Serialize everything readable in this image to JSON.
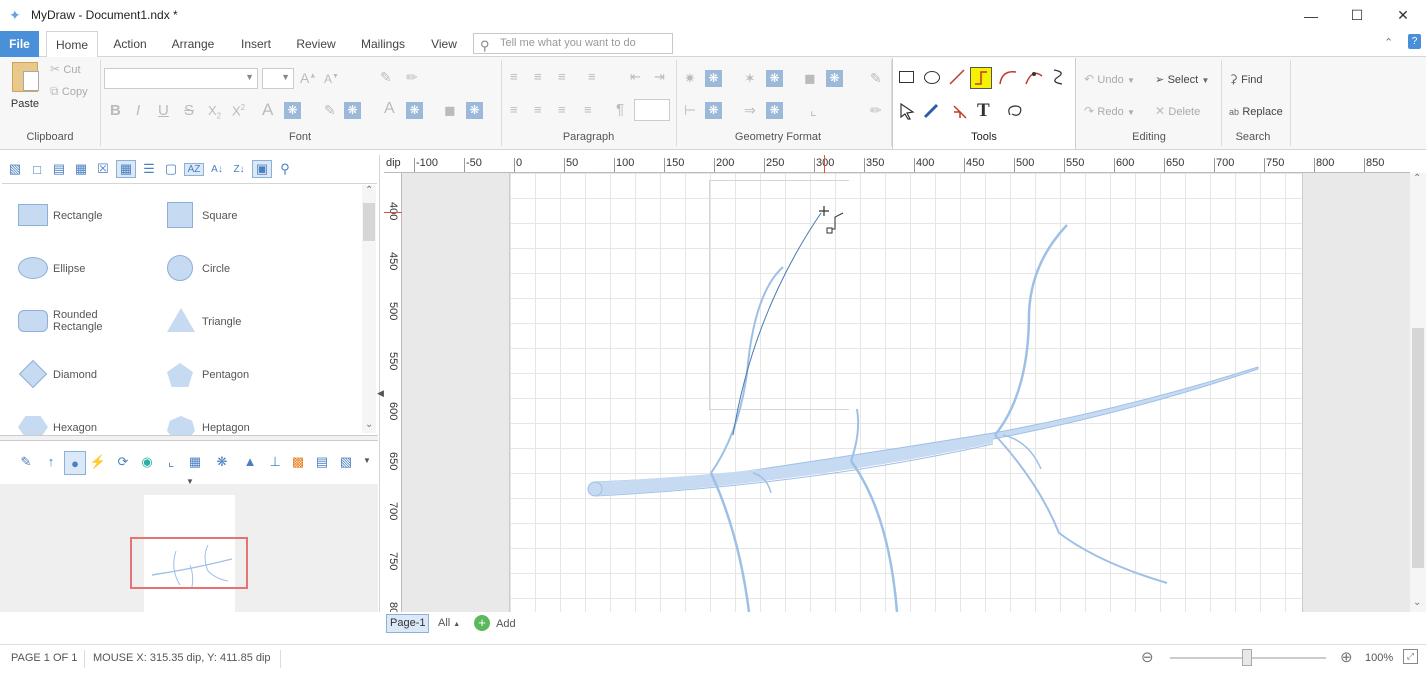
{
  "app": {
    "title": "MyDraw - Document1.ndx *"
  },
  "window_controls": {
    "minimize": "—",
    "maximize": "☐",
    "close": "✕"
  },
  "tabs": [
    {
      "label": "File"
    },
    {
      "label": "Home"
    },
    {
      "label": "Action"
    },
    {
      "label": "Arrange"
    },
    {
      "label": "Insert"
    },
    {
      "label": "Review"
    },
    {
      "label": "Mailings"
    },
    {
      "label": "View"
    }
  ],
  "search": {
    "placeholder": "Tell me what you want to do"
  },
  "ribbon": {
    "clipboard": {
      "label": "Clipboard",
      "paste": "Paste",
      "cut": "Cut",
      "copy": "Copy"
    },
    "font": {
      "label": "Font"
    },
    "paragraph": {
      "label": "Paragraph"
    },
    "geometry": {
      "label": "Geometry Format"
    },
    "tools": {
      "label": "Tools"
    },
    "editing": {
      "label": "Editing",
      "undo": "Undo",
      "redo": "Redo",
      "select": "Select",
      "delete": "Delete"
    },
    "search": {
      "label": "Search",
      "find": "Find",
      "replace": "Replace"
    }
  },
  "shapes": [
    {
      "label": "Rectangle",
      "kind": "rect"
    },
    {
      "label": "Square",
      "kind": "square"
    },
    {
      "label": "Ellipse",
      "kind": "ellipse"
    },
    {
      "label": "Circle",
      "kind": "circle"
    },
    {
      "label": "Rounded Rectangle",
      "kind": "rounded"
    },
    {
      "label": "Triangle",
      "kind": "triangle"
    },
    {
      "label": "Diamond",
      "kind": "diamond"
    },
    {
      "label": "Pentagon",
      "kind": "pentagon"
    },
    {
      "label": "Hexagon",
      "kind": "hexagon"
    },
    {
      "label": "Heptagon",
      "kind": "heptagon"
    }
  ],
  "ruler": {
    "unit": "dip",
    "h_ticks": [
      "-100",
      "-50",
      "0",
      "50",
      "100",
      "150",
      "200",
      "250",
      "300",
      "350",
      "400",
      "450",
      "500",
      "550",
      "600",
      "650",
      "700",
      "750",
      "800",
      "850"
    ],
    "v_ticks": [
      "400",
      "450",
      "500",
      "550",
      "600",
      "650",
      "700",
      "750",
      "80"
    ]
  },
  "pages": {
    "current": "Page-1",
    "all": "All",
    "add": "Add"
  },
  "status": {
    "page": "PAGE 1 OF 1",
    "mouse": "MOUSE X: 315.35 dip, Y: 411.85 dip",
    "zoom": "100%"
  },
  "colors": {
    "accent": "#4a90d9",
    "shape_fill": "#c6daf2",
    "stroke": "#9fc0e6",
    "selection": "#e57373",
    "tool_highlight": "#f5f100"
  }
}
